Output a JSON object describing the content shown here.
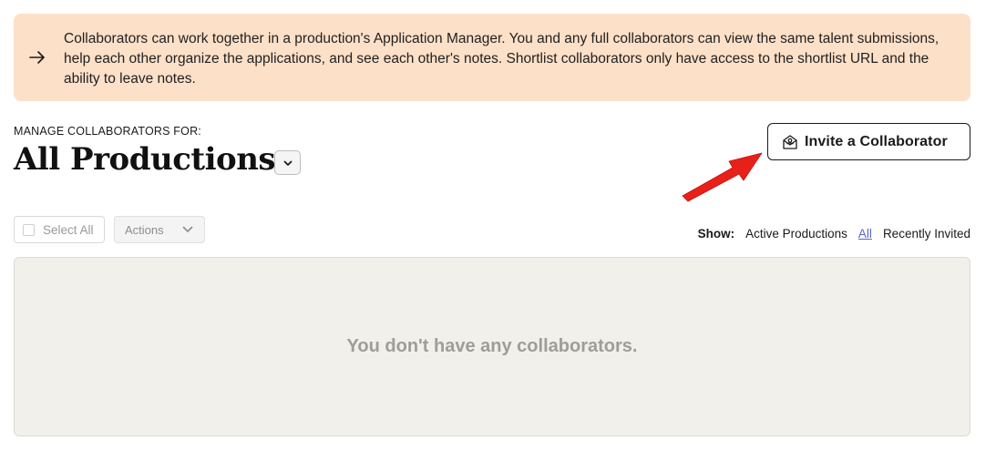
{
  "banner": {
    "icon": "arrow-right-icon",
    "text": "Collaborators can work together in a production's Application Manager. You and any full collaborators can view the same talent submissions, help each other organize the applications, and see each other's notes. Shortlist collaborators only have access to the shortlist URL and the ability to leave notes.",
    "background": "#fde0c8"
  },
  "header": {
    "manage_label": "MANAGE COLLABORATORS FOR:",
    "title": "All Productions",
    "dropdown_icon": "chevron-down-icon"
  },
  "invite": {
    "icon": "envelope-user-icon",
    "label": "Invite a Collaborator"
  },
  "annotation": {
    "icon": "red-arrow-icon",
    "color": "#e8201a"
  },
  "toolbar": {
    "select_all_label": "Select All",
    "actions_label": "Actions"
  },
  "filter": {
    "show_label": "Show:",
    "options": [
      "Active Productions",
      "All",
      "Recently Invited"
    ],
    "selected": "All",
    "link_color": "#5865c8"
  },
  "empty_state": {
    "message": "You don't have any collaborators."
  }
}
